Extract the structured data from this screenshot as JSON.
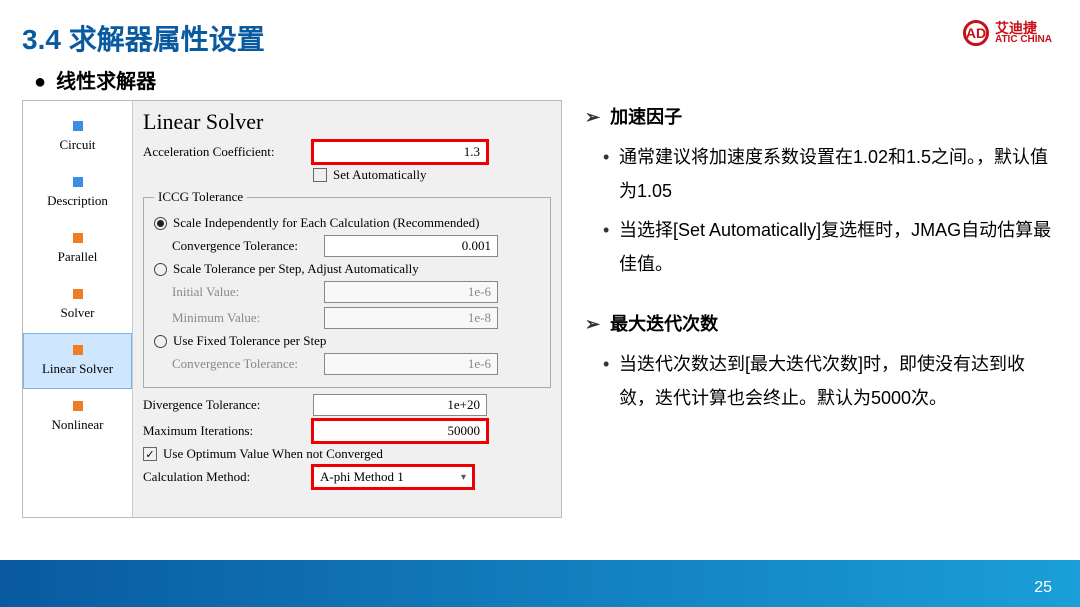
{
  "slide": {
    "title": "3.4 求解器属性设置",
    "subhead": "线性求解器",
    "page_number": "25"
  },
  "logo": {
    "cn": "艾迪捷",
    "en": "ATIC CHINA",
    "mark": "AD"
  },
  "tree": {
    "items": [
      {
        "label": "Circuit",
        "color": "blue"
      },
      {
        "label": "Description",
        "color": "blue"
      },
      {
        "label": "Parallel",
        "color": "orange"
      },
      {
        "label": "Solver",
        "color": "orange"
      },
      {
        "label": "Linear Solver",
        "color": "orange",
        "selected": true
      },
      {
        "label": "Nonlinear",
        "color": "orange"
      }
    ]
  },
  "panel": {
    "title": "Linear Solver",
    "accel_label": "Acceleration Coefficient:",
    "accel_value": "1.3",
    "set_auto": "Set Automatically",
    "iccg_legend": "ICCG Tolerance",
    "r1": "Scale Independently for Each Calculation (Recommended)",
    "conv_tol_label": "Convergence Tolerance:",
    "conv_tol_value": "0.001",
    "r2": "Scale Tolerance per Step, Adjust Automatically",
    "init_label": "Initial Value:",
    "init_value": "1e-6",
    "min_label": "Minimum Value:",
    "min_value": "1e-8",
    "r3": "Use Fixed Tolerance per Step",
    "conv_tol2_label": "Convergence Tolerance:",
    "conv_tol2_value": "1e-6",
    "div_tol_label": "Divergence Tolerance:",
    "div_tol_value": "1e+20",
    "max_iter_label": "Maximum Iterations:",
    "max_iter_value": "50000",
    "use_opt": "Use Optimum Value When not Converged",
    "calc_method_label": "Calculation Method:",
    "calc_method_value": "A-phi Method 1"
  },
  "notes": {
    "s1_title": "加速因子",
    "s1_b1": "通常建议将加速度系数设置在1.02和1.5之间。，默认值为1.05",
    "s1_b2": "当选择[Set Automatically]复选框时，JMAG自动估算最佳值。",
    "s2_title": "最大迭代次数",
    "s2_b1": "当迭代次数达到[最大迭代次数]时，即使没有达到收敛，迭代计算也会终止。默认为5000次。"
  }
}
